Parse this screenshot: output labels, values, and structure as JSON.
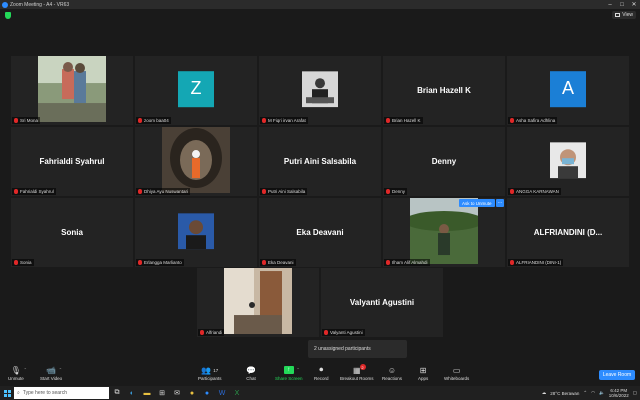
{
  "window": {
    "title": "Zoom Meeting - A4 - VR63"
  },
  "view_label": "View",
  "tiles": {
    "sri": {
      "name": "Sri Mona"
    },
    "zoom": {
      "name": "zoom baa04",
      "avatar_letter": "Z",
      "avatar_color": "#14a7b4"
    },
    "fiqri": {
      "name": "M Fiqri irvan Arafat"
    },
    "brian": {
      "name": "Brian Hazell K",
      "tag": "Brian Hazell K"
    },
    "asha": {
      "name": "Asha Safira Adhlina",
      "avatar_letter": "A",
      "avatar_color": "#1b7fd6"
    },
    "fahrialdi": {
      "name": "Fahrialdi Syahrul",
      "tag": "Fahrialdi Syahrul"
    },
    "dhiya": {
      "name": "Dhiya Ayu Nuswantari"
    },
    "putri": {
      "name": "Putri Aini Salsabila",
      "tag": "Putri Aini Salsabila"
    },
    "denny": {
      "name": "Denny",
      "tag": "Denny"
    },
    "angga": {
      "name": "ANGGA KARNAWAN"
    },
    "sonia": {
      "name": "Sonia",
      "tag": "Sonia"
    },
    "erlangga": {
      "name": "Erlangga Marlianto"
    },
    "eka": {
      "name": "Eka Deavani",
      "tag": "Eka Deavani"
    },
    "ilham": {
      "name": "Ilham Alif Almahdi"
    },
    "alfriandini": {
      "name": "ALFRIANDINI  (D...",
      "tag": "ALFRIANDINI (DINI-1)"
    },
    "alfriandi": {
      "name": "Alfriandi"
    },
    "valyanti": {
      "name": "Valyanti Agustini",
      "tag": "Valyanti Agustini"
    }
  },
  "add_to_unmute": "Ask to Unmute",
  "more": "···",
  "unassigned": "2 unassigned participants",
  "toolbar": {
    "unmute": "Unmute",
    "start_video": "Start Video",
    "participants": "Participants",
    "participants_count": "17",
    "chat": "Chat",
    "share_screen": "Share Screen",
    "record": "Record",
    "breakout_rooms": "Breakout Rooms",
    "breakout_badge": "2",
    "reactions": "Reactions",
    "apps": "Apps",
    "whiteboards": "Whiteboards",
    "leave": "Leave Room"
  },
  "taskbar": {
    "search_placeholder": "Type here to search",
    "weather": "28°C  Berawan",
    "time": "6:42 PM",
    "date": "10/6/2022"
  },
  "colors": {
    "accent": "#2d8cff",
    "green": "#23d959",
    "muted_red": "#e02828"
  }
}
